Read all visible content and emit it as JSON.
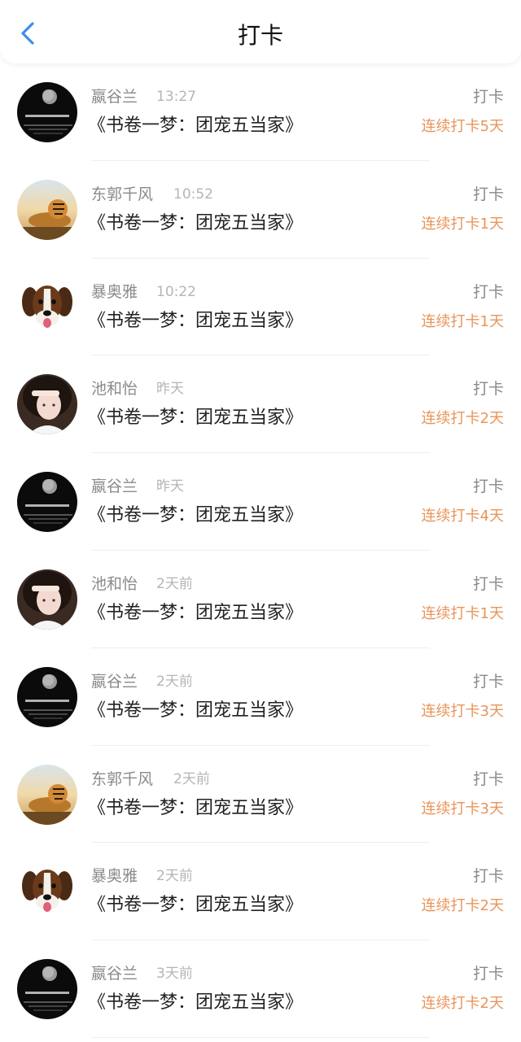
{
  "header": {
    "title": "打卡"
  },
  "theme": {
    "accent": "#3b8fe8",
    "streak_color": "#e8955a"
  },
  "items": [
    {
      "name": "嬴谷兰",
      "time": "13:27",
      "book": "《书卷一梦：团宠五当家》",
      "action": "打卡",
      "streak": "连续打卡5天",
      "avatar": "moon"
    },
    {
      "name": "东郭千风",
      "time": "10:52",
      "book": "《书卷一梦：团宠五当家》",
      "action": "打卡",
      "streak": "连续打卡1天",
      "avatar": "tiger"
    },
    {
      "name": "暴奥雅",
      "time": "10:22",
      "book": "《书卷一梦：团宠五当家》",
      "action": "打卡",
      "streak": "连续打卡1天",
      "avatar": "dog"
    },
    {
      "name": "池和怡",
      "time": "昨天",
      "book": "《书卷一梦：团宠五当家》",
      "action": "打卡",
      "streak": "连续打卡2天",
      "avatar": "girl"
    },
    {
      "name": "嬴谷兰",
      "time": "昨天",
      "book": "《书卷一梦：团宠五当家》",
      "action": "打卡",
      "streak": "连续打卡4天",
      "avatar": "moon"
    },
    {
      "name": "池和怡",
      "time": "2天前",
      "book": "《书卷一梦：团宠五当家》",
      "action": "打卡",
      "streak": "连续打卡1天",
      "avatar": "girl"
    },
    {
      "name": "嬴谷兰",
      "time": "2天前",
      "book": "《书卷一梦：团宠五当家》",
      "action": "打卡",
      "streak": "连续打卡3天",
      "avatar": "moon"
    },
    {
      "name": "东郭千风",
      "time": "2天前",
      "book": "《书卷一梦：团宠五当家》",
      "action": "打卡",
      "streak": "连续打卡3天",
      "avatar": "tiger"
    },
    {
      "name": "暴奥雅",
      "time": "2天前",
      "book": "《书卷一梦：团宠五当家》",
      "action": "打卡",
      "streak": "连续打卡2天",
      "avatar": "dog"
    },
    {
      "name": "嬴谷兰",
      "time": "3天前",
      "book": "《书卷一梦：团宠五当家》",
      "action": "打卡",
      "streak": "连续打卡2天",
      "avatar": "moon"
    }
  ]
}
